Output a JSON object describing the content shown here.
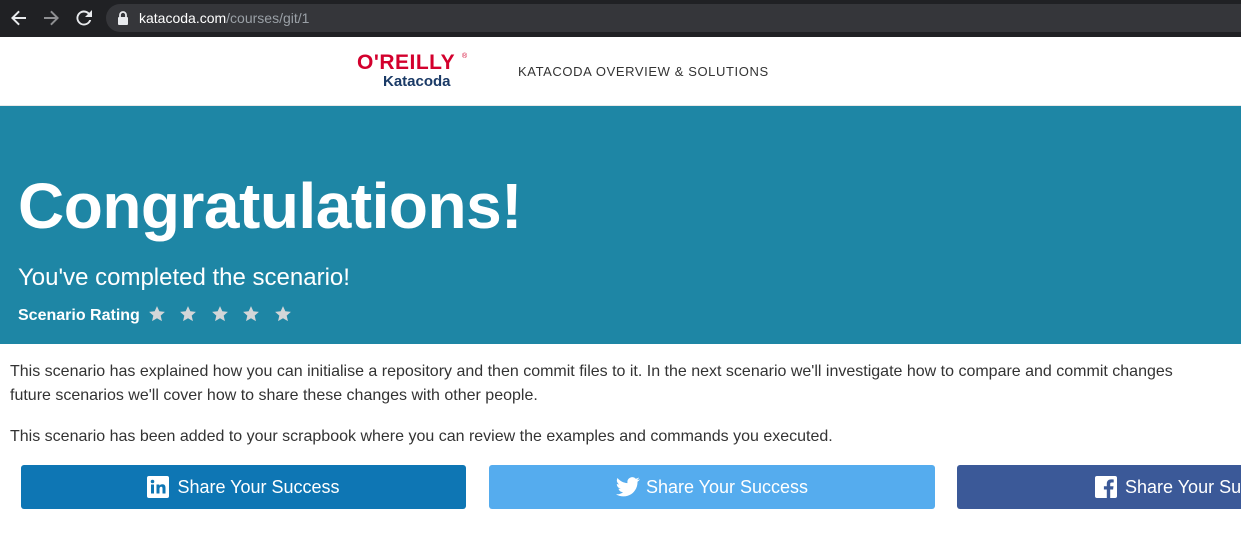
{
  "browser": {
    "url_host": "katacoda.com",
    "url_path": "/courses/git/1"
  },
  "header": {
    "logo_top": "O'REILLY",
    "logo_registered": "®",
    "logo_bottom": "Katacoda",
    "nav_link": "KATACODA OVERVIEW & SOLUTIONS"
  },
  "hero": {
    "title": "Congratulations!",
    "subtitle": "You've completed the scenario!",
    "rating_label": "Scenario Rating",
    "rating_stars_total": 5,
    "rating_stars_filled": 0
  },
  "body": {
    "paragraph1_line1": "This scenario has explained how you can initialise a repository and then commit files to it. In the next scenario we'll investigate how to compare and commit changes",
    "paragraph1_line2": "future scenarios we'll cover how to share these changes with other people.",
    "paragraph2": "This scenario has been added to your scrapbook where you can review the examples and commands you executed."
  },
  "share": [
    {
      "label": "Share Your Success",
      "network": "linkedin",
      "icon": "linkedin-icon",
      "color": "#0e76b4"
    },
    {
      "label": "Share Your Success",
      "network": "twitter",
      "icon": "twitter-icon",
      "color": "#55acee"
    },
    {
      "label": "Share Your Succe",
      "network": "facebook",
      "icon": "facebook-icon",
      "color": "#3b5998"
    }
  ],
  "colors": {
    "hero_bg": "#1e86a5",
    "brand_red": "#d3002d",
    "brand_navy": "#1a3a66",
    "chrome_bg": "#202124"
  }
}
